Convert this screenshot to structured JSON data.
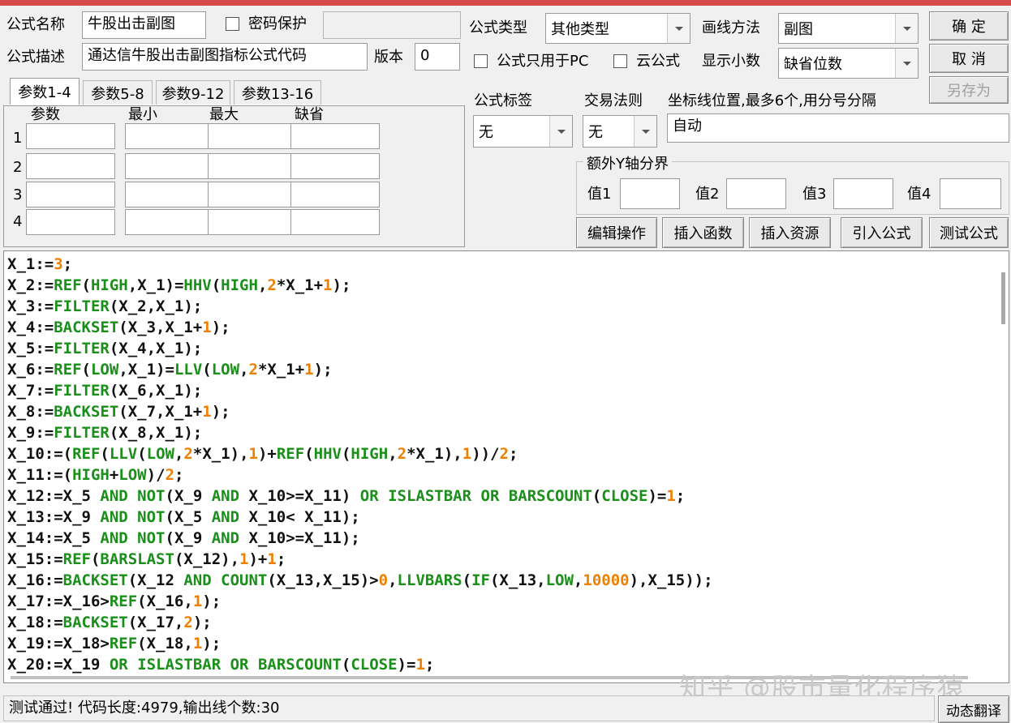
{
  "header": {
    "formula_name_label": "公式名称",
    "formula_name_value": "牛股出击副图",
    "password_label": "密码保护",
    "formula_desc_label": "公式描述",
    "formula_desc_value": "通达信牛股出击副图指标公式代码",
    "version_label": "版本",
    "version_value": "0",
    "type_label": "公式类型",
    "type_value": "其他类型",
    "draw_label": "画线方法",
    "draw_value": "副图",
    "pc_only_label": "公式只用于PC",
    "cloud_label": "云公式",
    "decimals_label": "显示小数",
    "decimals_value": "缺省位数",
    "confirm_label": "确 定",
    "cancel_label": "取 消",
    "save_as_label": "另存为"
  },
  "params": {
    "tabs": [
      "参数1-4",
      "参数5-8",
      "参数9-12",
      "参数13-16"
    ],
    "columns": [
      "参数",
      "最小",
      "最大",
      "缺省"
    ],
    "rows": [
      "1",
      "2",
      "3",
      "4"
    ]
  },
  "right_panel": {
    "tag_label": "公式标签",
    "tag_value": "无",
    "rule_label": "交易法则",
    "rule_value": "无",
    "axis_label": "坐标线位置,最多6个,用分号分隔",
    "axis_value": "自动",
    "yaxis_group": "额外Y轴分界",
    "val_labels": [
      "值1",
      "值2",
      "值3",
      "值4"
    ]
  },
  "actions": {
    "edit": "编辑操作",
    "insert_func": "插入函数",
    "insert_res": "插入资源",
    "import": "引入公式",
    "test": "测试公式"
  },
  "code_lines": [
    [
      [
        "p",
        "X_1:="
      ],
      [
        "n",
        "3"
      ],
      [
        "p",
        ";"
      ]
    ],
    [
      [
        "p",
        "X_2:="
      ],
      [
        "k",
        "REF"
      ],
      [
        "p",
        "("
      ],
      [
        "k",
        "HIGH"
      ],
      [
        "p",
        ",X_1)="
      ],
      [
        "k",
        "HHV"
      ],
      [
        "p",
        "("
      ],
      [
        "k",
        "HIGH"
      ],
      [
        "p",
        ","
      ],
      [
        "n",
        "2"
      ],
      [
        "p",
        "*X_1+"
      ],
      [
        "n",
        "1"
      ],
      [
        "p",
        ");"
      ]
    ],
    [
      [
        "p",
        "X_3:="
      ],
      [
        "k",
        "FILTER"
      ],
      [
        "p",
        "(X_2,X_1);"
      ]
    ],
    [
      [
        "p",
        "X_4:="
      ],
      [
        "k",
        "BACKSET"
      ],
      [
        "p",
        "(X_3,X_1+"
      ],
      [
        "n",
        "1"
      ],
      [
        "p",
        ");"
      ]
    ],
    [
      [
        "p",
        "X_5:="
      ],
      [
        "k",
        "FILTER"
      ],
      [
        "p",
        "(X_4,X_1);"
      ]
    ],
    [
      [
        "p",
        "X_6:="
      ],
      [
        "k",
        "REF"
      ],
      [
        "p",
        "("
      ],
      [
        "k",
        "LOW"
      ],
      [
        "p",
        ",X_1)="
      ],
      [
        "k",
        "LLV"
      ],
      [
        "p",
        "("
      ],
      [
        "k",
        "LOW"
      ],
      [
        "p",
        ","
      ],
      [
        "n",
        "2"
      ],
      [
        "p",
        "*X_1+"
      ],
      [
        "n",
        "1"
      ],
      [
        "p",
        ");"
      ]
    ],
    [
      [
        "p",
        "X_7:="
      ],
      [
        "k",
        "FILTER"
      ],
      [
        "p",
        "(X_6,X_1);"
      ]
    ],
    [
      [
        "p",
        "X_8:="
      ],
      [
        "k",
        "BACKSET"
      ],
      [
        "p",
        "(X_7,X_1+"
      ],
      [
        "n",
        "1"
      ],
      [
        "p",
        ");"
      ]
    ],
    [
      [
        "p",
        "X_9:="
      ],
      [
        "k",
        "FILTER"
      ],
      [
        "p",
        "(X_8,X_1);"
      ]
    ],
    [
      [
        "p",
        "X_10:=("
      ],
      [
        "k",
        "REF"
      ],
      [
        "p",
        "("
      ],
      [
        "k",
        "LLV"
      ],
      [
        "p",
        "("
      ],
      [
        "k",
        "LOW"
      ],
      [
        "p",
        ","
      ],
      [
        "n",
        "2"
      ],
      [
        "p",
        "*X_1),"
      ],
      [
        "n",
        "1"
      ],
      [
        "p",
        ")+"
      ],
      [
        "k",
        "REF"
      ],
      [
        "p",
        "("
      ],
      [
        "k",
        "HHV"
      ],
      [
        "p",
        "("
      ],
      [
        "k",
        "HIGH"
      ],
      [
        "p",
        ","
      ],
      [
        "n",
        "2"
      ],
      [
        "p",
        "*X_1),"
      ],
      [
        "n",
        "1"
      ],
      [
        "p",
        "))/"
      ],
      [
        "n",
        "2"
      ],
      [
        "p",
        ";"
      ]
    ],
    [
      [
        "p",
        "X_11:=("
      ],
      [
        "k",
        "HIGH"
      ],
      [
        "p",
        "+"
      ],
      [
        "k",
        "LOW"
      ],
      [
        "p",
        ")/"
      ],
      [
        "n",
        "2"
      ],
      [
        "p",
        ";"
      ]
    ],
    [
      [
        "p",
        "X_12:=X_5 "
      ],
      [
        "k",
        "AND"
      ],
      [
        "p",
        " "
      ],
      [
        "k",
        "NOT"
      ],
      [
        "p",
        "(X_9 "
      ],
      [
        "k",
        "AND"
      ],
      [
        "p",
        " X_10>=X_11) "
      ],
      [
        "k",
        "OR"
      ],
      [
        "p",
        " "
      ],
      [
        "k",
        "ISLASTBAR"
      ],
      [
        "p",
        " "
      ],
      [
        "k",
        "OR"
      ],
      [
        "p",
        " "
      ],
      [
        "k",
        "BARSCOUNT"
      ],
      [
        "p",
        "("
      ],
      [
        "k",
        "CLOSE"
      ],
      [
        "p",
        ")="
      ],
      [
        "n",
        "1"
      ],
      [
        "p",
        ";"
      ]
    ],
    [
      [
        "p",
        "X_13:=X_9 "
      ],
      [
        "k",
        "AND"
      ],
      [
        "p",
        " "
      ],
      [
        "k",
        "NOT"
      ],
      [
        "p",
        "(X_5 "
      ],
      [
        "k",
        "AND"
      ],
      [
        "p",
        " X_10< X_11);"
      ]
    ],
    [
      [
        "p",
        "X_14:=X_5 "
      ],
      [
        "k",
        "AND"
      ],
      [
        "p",
        " "
      ],
      [
        "k",
        "NOT"
      ],
      [
        "p",
        "(X_9 "
      ],
      [
        "k",
        "AND"
      ],
      [
        "p",
        " X_10>=X_11);"
      ]
    ],
    [
      [
        "p",
        "X_15:="
      ],
      [
        "k",
        "REF"
      ],
      [
        "p",
        "("
      ],
      [
        "k",
        "BARSLAST"
      ],
      [
        "p",
        "(X_12),"
      ],
      [
        "n",
        "1"
      ],
      [
        "p",
        ")+"
      ],
      [
        "n",
        "1"
      ],
      [
        "p",
        ";"
      ]
    ],
    [
      [
        "p",
        "X_16:="
      ],
      [
        "k",
        "BACKSET"
      ],
      [
        "p",
        "(X_12 "
      ],
      [
        "k",
        "AND"
      ],
      [
        "p",
        " "
      ],
      [
        "k",
        "COUNT"
      ],
      [
        "p",
        "(X_13,X_15)>"
      ],
      [
        "n",
        "0"
      ],
      [
        "p",
        ","
      ],
      [
        "k",
        "LLVBARS"
      ],
      [
        "p",
        "("
      ],
      [
        "k",
        "IF"
      ],
      [
        "p",
        "(X_13,"
      ],
      [
        "k",
        "LOW"
      ],
      [
        "p",
        ","
      ],
      [
        "n",
        "10000"
      ],
      [
        "p",
        "),X_15));"
      ]
    ],
    [
      [
        "p",
        "X_17:=X_16>"
      ],
      [
        "k",
        "REF"
      ],
      [
        "p",
        "(X_16,"
      ],
      [
        "n",
        "1"
      ],
      [
        "p",
        ");"
      ]
    ],
    [
      [
        "p",
        "X_18:="
      ],
      [
        "k",
        "BACKSET"
      ],
      [
        "p",
        "(X_17,"
      ],
      [
        "n",
        "2"
      ],
      [
        "p",
        ");"
      ]
    ],
    [
      [
        "p",
        "X_19:=X_18>"
      ],
      [
        "k",
        "REF"
      ],
      [
        "p",
        "(X_18,"
      ],
      [
        "n",
        "1"
      ],
      [
        "p",
        ");"
      ]
    ],
    [
      [
        "p",
        "X_20:=X_19 "
      ],
      [
        "k",
        "OR"
      ],
      [
        "p",
        " "
      ],
      [
        "k",
        "ISLASTBAR"
      ],
      [
        "p",
        " "
      ],
      [
        "k",
        "OR"
      ],
      [
        "p",
        " "
      ],
      [
        "k",
        "BARSCOUNT"
      ],
      [
        "p",
        "("
      ],
      [
        "k",
        "CLOSE"
      ],
      [
        "p",
        ")="
      ],
      [
        "n",
        "1"
      ],
      [
        "p",
        ";"
      ]
    ]
  ],
  "watermark": "知乎 @股市量化程序猿",
  "status": {
    "text": "测试通过! 代码长度:4979,输出线个数:30",
    "translate_label": "动态翻译"
  },
  "colors": {
    "keyword": "#1a8f1a",
    "number": "#ef7f00",
    "title_bar": "#d8494a"
  }
}
